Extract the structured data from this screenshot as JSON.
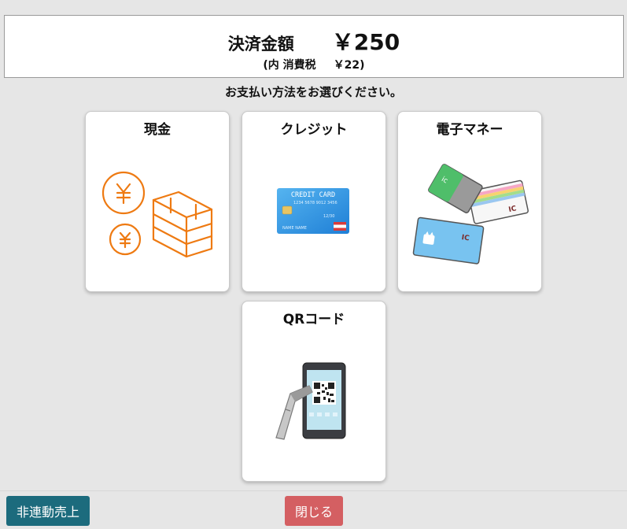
{
  "header": {
    "amount_label": "決済金額",
    "amount_value": "￥250",
    "tax_open": "(内 消費税",
    "tax_value": "￥22)"
  },
  "instruction": "お支払い方法をお選びください。",
  "methods": [
    {
      "label": "現金",
      "icon": "cash-icon",
      "color": "#ee7a12"
    },
    {
      "label": "クレジット",
      "icon": "credit-card-icon",
      "color": "#2b8fe0"
    },
    {
      "label": "電子マネー",
      "icon": "ic-cards-icon",
      "color": "#5aaee2"
    },
    {
      "label": "QRコード",
      "icon": "qr-scanner-icon",
      "color": "#333333"
    }
  ],
  "credit_card_text": {
    "brand": "CREDIT CARD",
    "number": "1234 5678 9012 3456",
    "name": "NAME NAME",
    "expiry": "12/30"
  },
  "ic_text": "IC",
  "footer": {
    "offline_label": "非連動売上",
    "close_label": "閉じる"
  },
  "colors": {
    "background": "#e6e6e6",
    "offline_button": "#1c6b7d",
    "close_button": "#d45f62"
  }
}
